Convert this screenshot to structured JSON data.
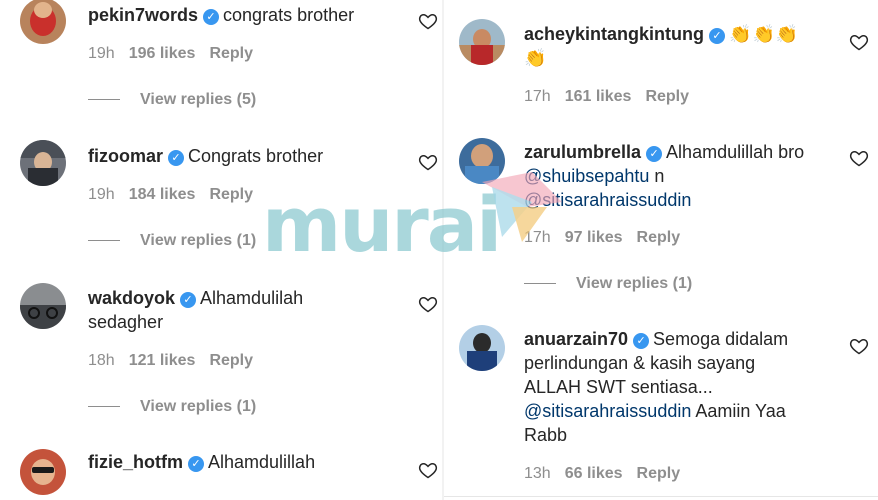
{
  "left_comments": [
    {
      "username": "pekin7words",
      "text": "congrats brother",
      "time": "19h",
      "likes": "196 likes",
      "reply": "Reply",
      "view_replies": "View replies (5)"
    },
    {
      "username": "fizoomar",
      "text": "Congrats brother",
      "time": "19h",
      "likes": "184 likes",
      "reply": "Reply",
      "view_replies": "View replies (1)"
    },
    {
      "username": "wakdoyok",
      "text_line1": "Alhamdulilah",
      "text_line2": "sedagher",
      "time": "18h",
      "likes": "121 likes",
      "reply": "Reply",
      "view_replies": "View replies (1)"
    },
    {
      "username": "fizie_hotfm",
      "text": "Alhamdulillah"
    }
  ],
  "right_comments": [
    {
      "username": "acheykintangkintung",
      "emoji_line1": "👏👏👏",
      "emoji_line2": "👏",
      "time": "17h",
      "likes": "161 likes",
      "reply": "Reply"
    },
    {
      "username": "zarulumbrella",
      "text": "Alhamdulillah bro",
      "mention1": "@shuibsepahtu",
      "text2": "n",
      "mention2": "@sitisarahraissuddin",
      "time": "17h",
      "likes": "97 likes",
      "reply": "Reply",
      "view_replies": "View replies (1)"
    },
    {
      "username": "anuarzain70",
      "text_line1": "Semoga didalam",
      "text_line2": "perlindungan & kasih sayang",
      "text_line3": "ALLAH SWT sentiasa...",
      "mention": "@sitisarahraissuddin",
      "text_after": "Aamiin Yaa",
      "text_line5": "Rabb",
      "time": "13h",
      "likes": "66 likes",
      "reply": "Reply"
    }
  ],
  "icons": {
    "verified": "verified-badge-icon",
    "like": "heart-icon"
  },
  "watermark": {
    "text": "murai"
  },
  "colors": {
    "verified": "#3897f0",
    "mention": "#00376b",
    "meta": "#8e8e8e",
    "watermark": "#8ac8cf"
  }
}
